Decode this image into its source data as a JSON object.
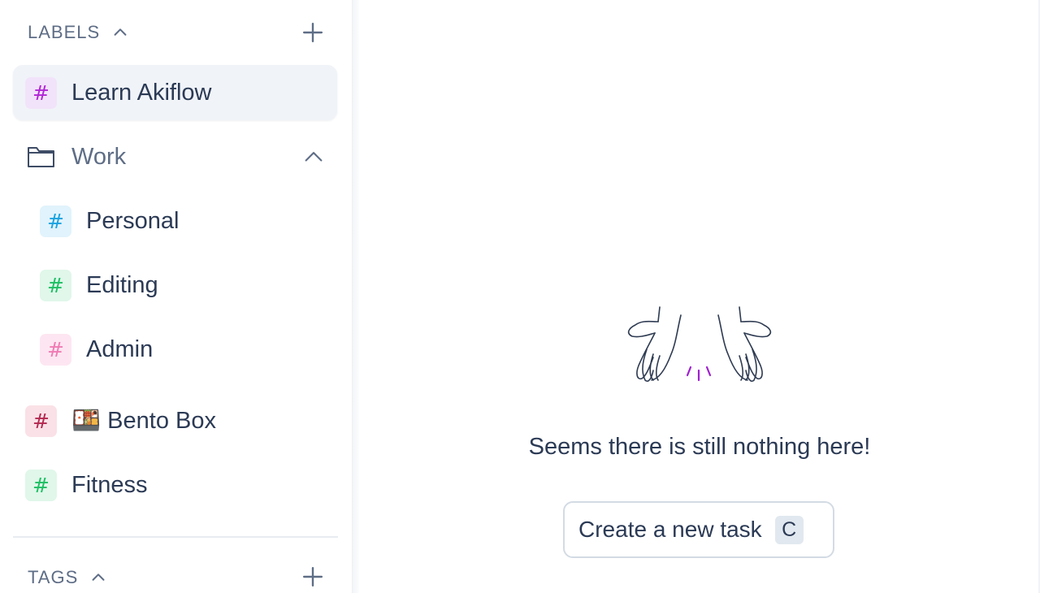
{
  "labels_section": {
    "title": "LABELS",
    "items": [
      {
        "label": "Learn Akiflow",
        "hash": "#",
        "hash_color": "#b125d6",
        "hash_bg": "#f1e3fa",
        "active": true
      },
      {
        "label": "Work",
        "type": "folder",
        "expanded": true,
        "icon": "folder-icon"
      },
      {
        "label": "Personal",
        "hash": "#",
        "hash_color": "#1aa3e0",
        "hash_bg": "#e1f3fc",
        "nested": true
      },
      {
        "label": "Editing",
        "hash": "#",
        "hash_color": "#1ebf63",
        "hash_bg": "#e0f7ea",
        "nested": true
      },
      {
        "label": "Admin",
        "hash": "#",
        "hash_color": "#f07bb4",
        "hash_bg": "#fde6f1",
        "nested": true
      },
      {
        "label": "🍱 Bento Box",
        "hash": "#",
        "hash_color": "#b3284f",
        "hash_bg": "#fae1e7"
      },
      {
        "label": "Fitness",
        "hash": "#",
        "hash_color": "#1ebf63",
        "hash_bg": "#e0f7ea"
      }
    ]
  },
  "tags_section": {
    "title": "TAGS"
  },
  "empty_state": {
    "message": "Seems there is still nothing here!",
    "create_button": "Create a new task",
    "shortcut": "C",
    "illustration": "open-hands-icon",
    "accent": "#a020d0"
  }
}
